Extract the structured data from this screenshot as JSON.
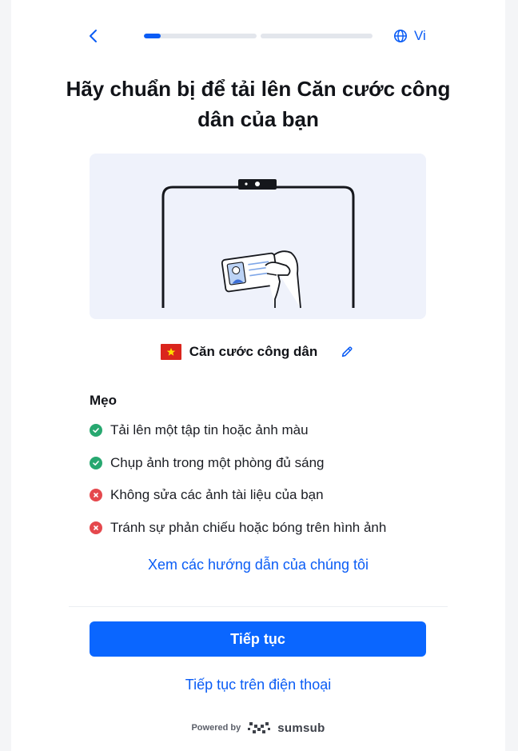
{
  "header": {
    "back_icon": "chevron-left-icon",
    "progress": {
      "segments": 2,
      "current_segment_fill": 0.15
    },
    "language_icon": "globe-icon",
    "language_label": "Vi"
  },
  "title": "Hãy chuẩn bị để tải lên Căn cước công dân của bạn",
  "document": {
    "flag_icon": "vietnam-flag-icon",
    "label": "Căn cước công dân",
    "edit_icon": "pencil-icon"
  },
  "tips": {
    "title": "Mẹo",
    "items": [
      {
        "text": "Tải lên một tập tin hoặc ảnh màu",
        "status": "ok"
      },
      {
        "text": "Chụp ảnh trong một phòng đủ sáng",
        "status": "ok"
      },
      {
        "text": "Không sửa các ảnh tài liệu của bạn",
        "status": "bad"
      },
      {
        "text": "Tránh sự phản chiếu hoặc bóng trên hình ảnh",
        "status": "bad"
      }
    ]
  },
  "guide_link": "Xem các hướng dẫn của chúng tôi",
  "continue_button": "Tiếp tục",
  "continue_on_phone": "Tiếp tục trên điện thoại",
  "footer": {
    "powered_by": "Powered by",
    "brand": "sumsub"
  },
  "colors": {
    "accent": "#0a66ff",
    "link": "#0a5cf5",
    "ok": "#27a870",
    "bad": "#e5484d"
  }
}
